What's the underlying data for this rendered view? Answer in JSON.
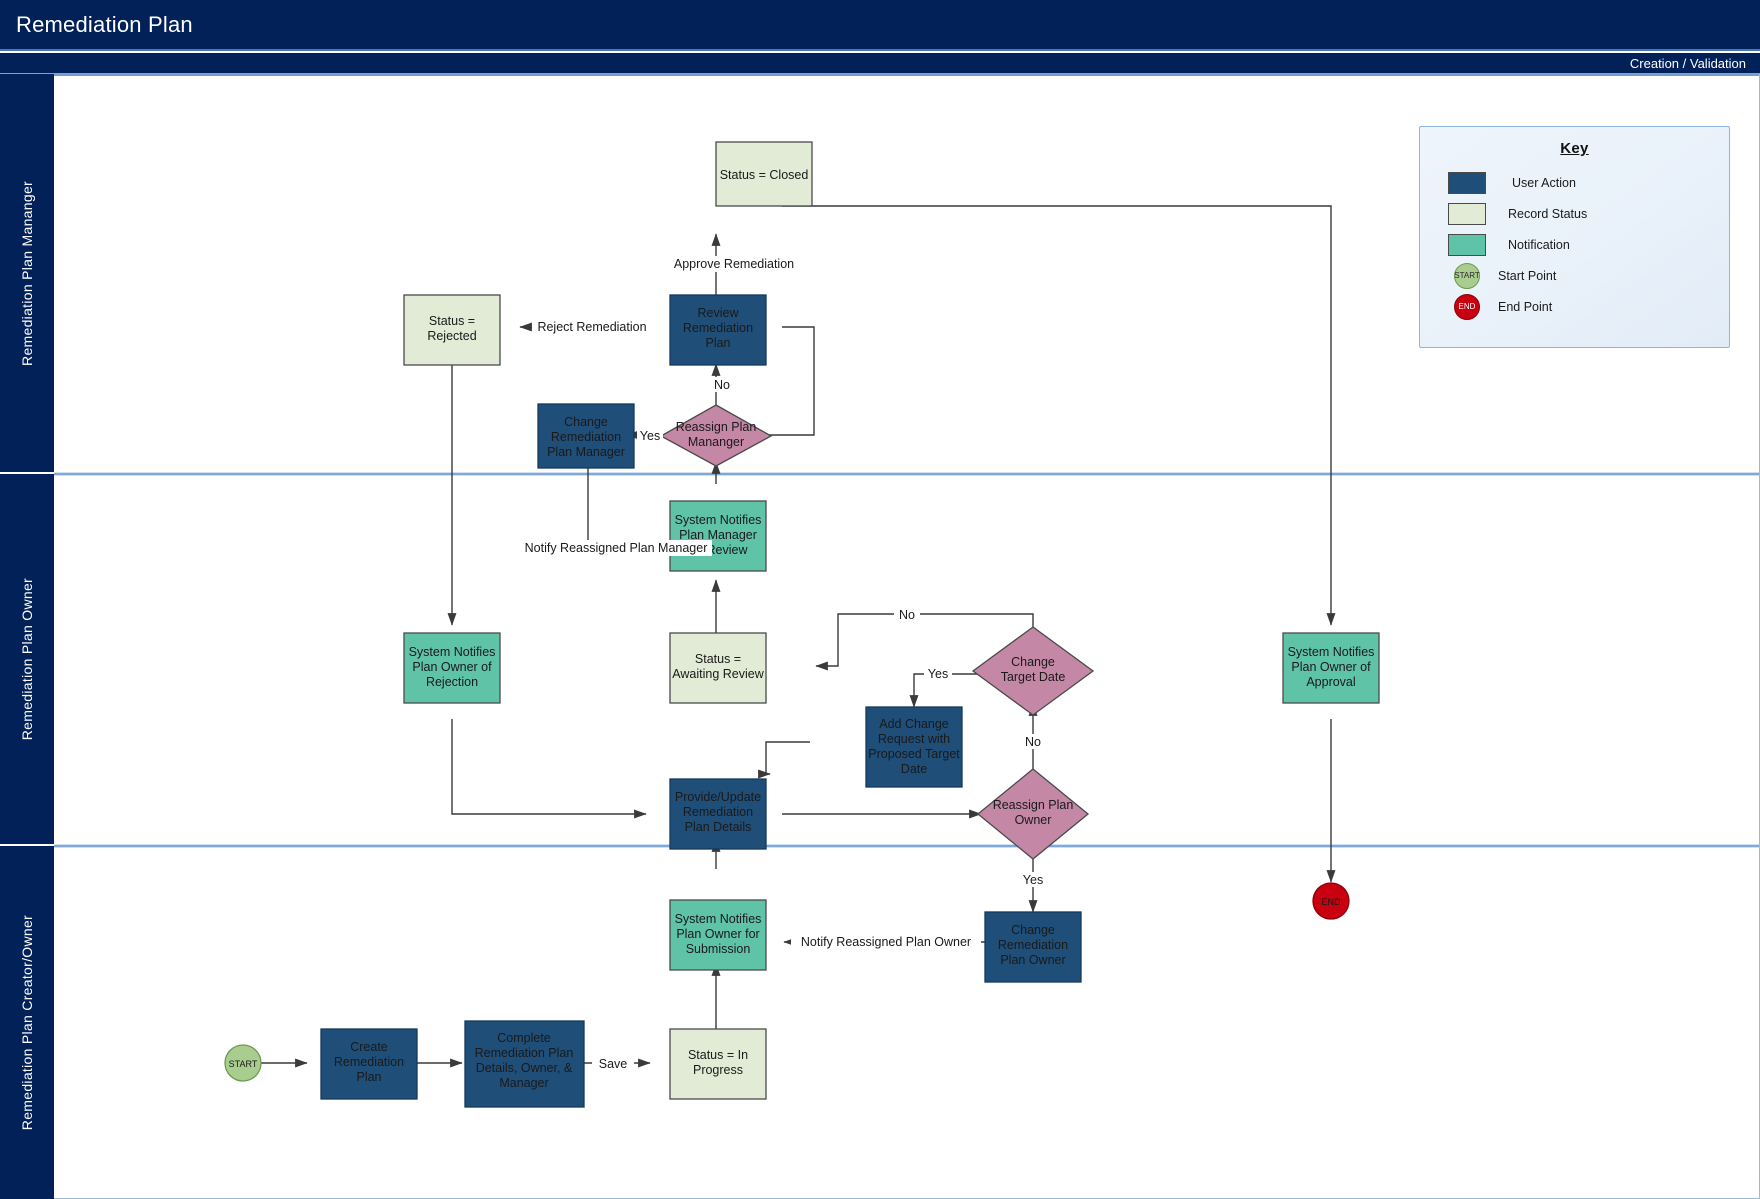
{
  "header": {
    "title": "Remediation Plan",
    "phase": "Creation / Validation"
  },
  "lanes": [
    {
      "id": "manager",
      "label": "Remediation Plan Mananger"
    },
    {
      "id": "owner",
      "label": "Remediation Plan Owner"
    },
    {
      "id": "creator",
      "label": "Remediation Plan Creator/Owner"
    }
  ],
  "key": {
    "title": "Key",
    "items": [
      {
        "label": "User Action",
        "shape": "rect",
        "color": "#1F4E79"
      },
      {
        "label": "Record Status",
        "shape": "rect",
        "color": "#E2EBD5"
      },
      {
        "label": "Notification",
        "shape": "rect",
        "color": "#5FC3A8"
      },
      {
        "label": "Start Point",
        "shape": "circle",
        "color": "#A9CC8F",
        "text": "START"
      },
      {
        "label": "End Point",
        "shape": "circle",
        "color": "#C8000F",
        "text": "END"
      }
    ]
  },
  "palette": {
    "user_action": "#1F4E79",
    "record_status": "#E2EBD5",
    "notification": "#5FC3A8",
    "decision": "#C487A6",
    "start": "#A9CC8F",
    "end": "#C8000F",
    "connector": "#3a3a3a",
    "lane_header": "#012158",
    "lane_divider": "#6f9ed6"
  },
  "nodes": {
    "status_closed": {
      "label": "Status = Closed",
      "type": "record_status"
    },
    "status_rejected": {
      "label": "Status =|Rejected",
      "type": "record_status"
    },
    "review_plan": {
      "label": "Review|Remediation|Plan",
      "type": "user_action"
    },
    "reassign_plan_manager": {
      "label": "Reassign Plan|Mananger",
      "type": "decision"
    },
    "change_plan_manager": {
      "label": "Change|Remediation|Plan Manager",
      "type": "user_action"
    },
    "notify_mgr_review": {
      "label": "System Notifies|Plan Manager|for Review",
      "type": "notification"
    },
    "notify_owner_reject": {
      "label": "System Notifies|Plan Owner of|Rejection",
      "type": "notification"
    },
    "status_awaiting": {
      "label": "Status =|Awaiting Review",
      "type": "record_status"
    },
    "change_target_date": {
      "label": "Change|Target Date",
      "type": "decision"
    },
    "add_change_request": {
      "label": "Add Change|Request with|Proposed Target|Date",
      "type": "user_action"
    },
    "provide_update": {
      "label": "Provide/Update|Remediation|Plan Details",
      "type": "user_action"
    },
    "reassign_plan_owner": {
      "label": "Reassign Plan|Owner",
      "type": "decision"
    },
    "change_plan_owner": {
      "label": "Change|Remediation|Plan Owner",
      "type": "user_action"
    },
    "notify_owner_submit": {
      "label": "System Notifies|Plan Owner for|Submission",
      "type": "notification"
    },
    "notify_owner_approval": {
      "label": "System Notifies|Plan Owner of|Approval",
      "type": "notification"
    },
    "status_in_progress": {
      "label": "Status = In|Progress",
      "type": "record_status"
    },
    "create_plan": {
      "label": "Create|Remediation|Plan",
      "type": "user_action"
    },
    "complete_plan": {
      "label": "Complete|Remediation Plan|Details, Owner, &|Manager",
      "type": "user_action"
    },
    "start_point": {
      "label": "START",
      "type": "start"
    },
    "end_point": {
      "label": "END",
      "type": "end"
    }
  },
  "edge_labels": {
    "approve_remediation": "Approve Remediation",
    "reject_remediation": "Reject Remediation",
    "mgr_no": "No",
    "mgr_yes": "Yes",
    "notify_reassigned_manager": "Notify Reassigned Plan Manager",
    "target_no_top": "No",
    "target_yes": "Yes",
    "target_no_bottom": "No",
    "owner_yes": "Yes",
    "notify_reassigned_owner": "Notify Reassigned Plan Owner",
    "save": "Save"
  }
}
